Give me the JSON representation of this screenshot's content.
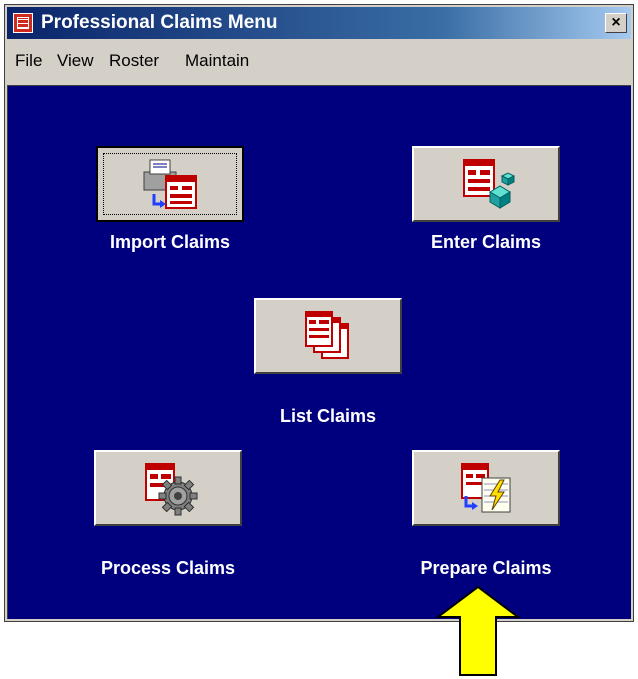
{
  "window": {
    "title": "Professional Claims Menu",
    "close_label": "×"
  },
  "menu": {
    "items": [
      {
        "label": "File"
      },
      {
        "label": "View"
      },
      {
        "label": "Roster"
      },
      {
        "label": "Maintain"
      }
    ]
  },
  "actions": {
    "import": {
      "label": "Import Claims",
      "icon": "printer-form-icon"
    },
    "enter": {
      "label": "Enter Claims",
      "icon": "form-cubes-icon"
    },
    "list": {
      "label": "List Claims",
      "icon": "stacked-forms-icon"
    },
    "process": {
      "label": "Process Claims",
      "icon": "form-gear-icon"
    },
    "prepare": {
      "label": "Prepare Claims",
      "icon": "form-notepad-icon"
    }
  },
  "annotation": {
    "arrow_color": "#ffff00",
    "points_to": "Prepare Claims"
  },
  "colors": {
    "client_background": "#00007f",
    "titlebar": "#0a246a",
    "face": "#d4d0c8"
  }
}
